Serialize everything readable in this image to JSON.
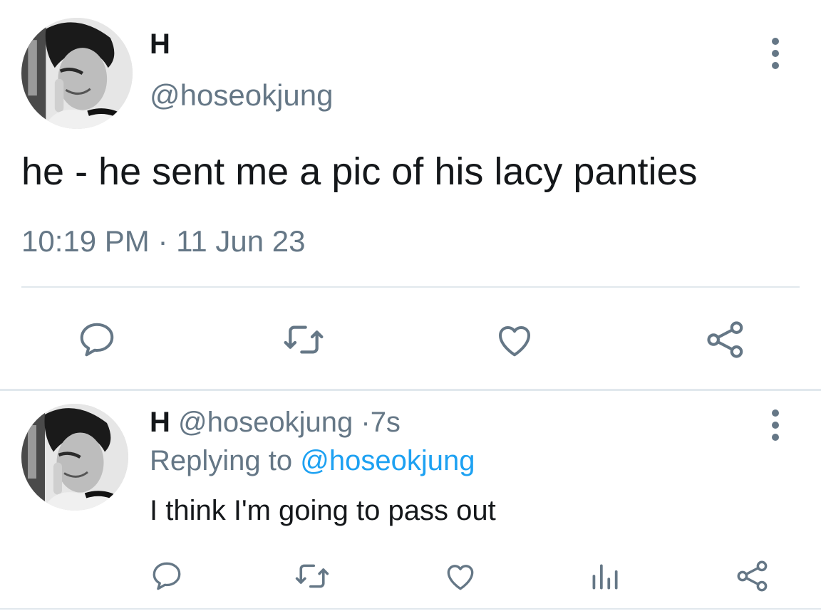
{
  "colors": {
    "primary_text": "#14171a",
    "secondary_text": "#657786",
    "link": "#1da1f2",
    "divider": "#e1e8ed",
    "background": "#ffffff"
  },
  "main_tweet": {
    "display_name": "H",
    "handle": "@hoseokjung",
    "text": "he - he sent me a pic of his lacy panties",
    "timestamp": "10:19 PM · 11 Jun 23",
    "actions": [
      {
        "name": "reply",
        "icon": "speech-bubble-icon"
      },
      {
        "name": "retweet",
        "icon": "retweet-icon"
      },
      {
        "name": "like",
        "icon": "heart-icon"
      },
      {
        "name": "share",
        "icon": "share-icon"
      }
    ]
  },
  "reply_tweet": {
    "display_name": "H",
    "handle": "@hoseokjung",
    "separator": "·",
    "time_ago": "7s",
    "replying_prefix": "Replying to",
    "replying_to": "@hoseokjung",
    "text": "I think I'm going to pass out",
    "actions": [
      {
        "name": "reply",
        "icon": "speech-bubble-icon"
      },
      {
        "name": "retweet",
        "icon": "retweet-icon"
      },
      {
        "name": "like",
        "icon": "heart-icon"
      },
      {
        "name": "analytics",
        "icon": "bar-chart-icon"
      },
      {
        "name": "share",
        "icon": "share-icon"
      }
    ]
  }
}
